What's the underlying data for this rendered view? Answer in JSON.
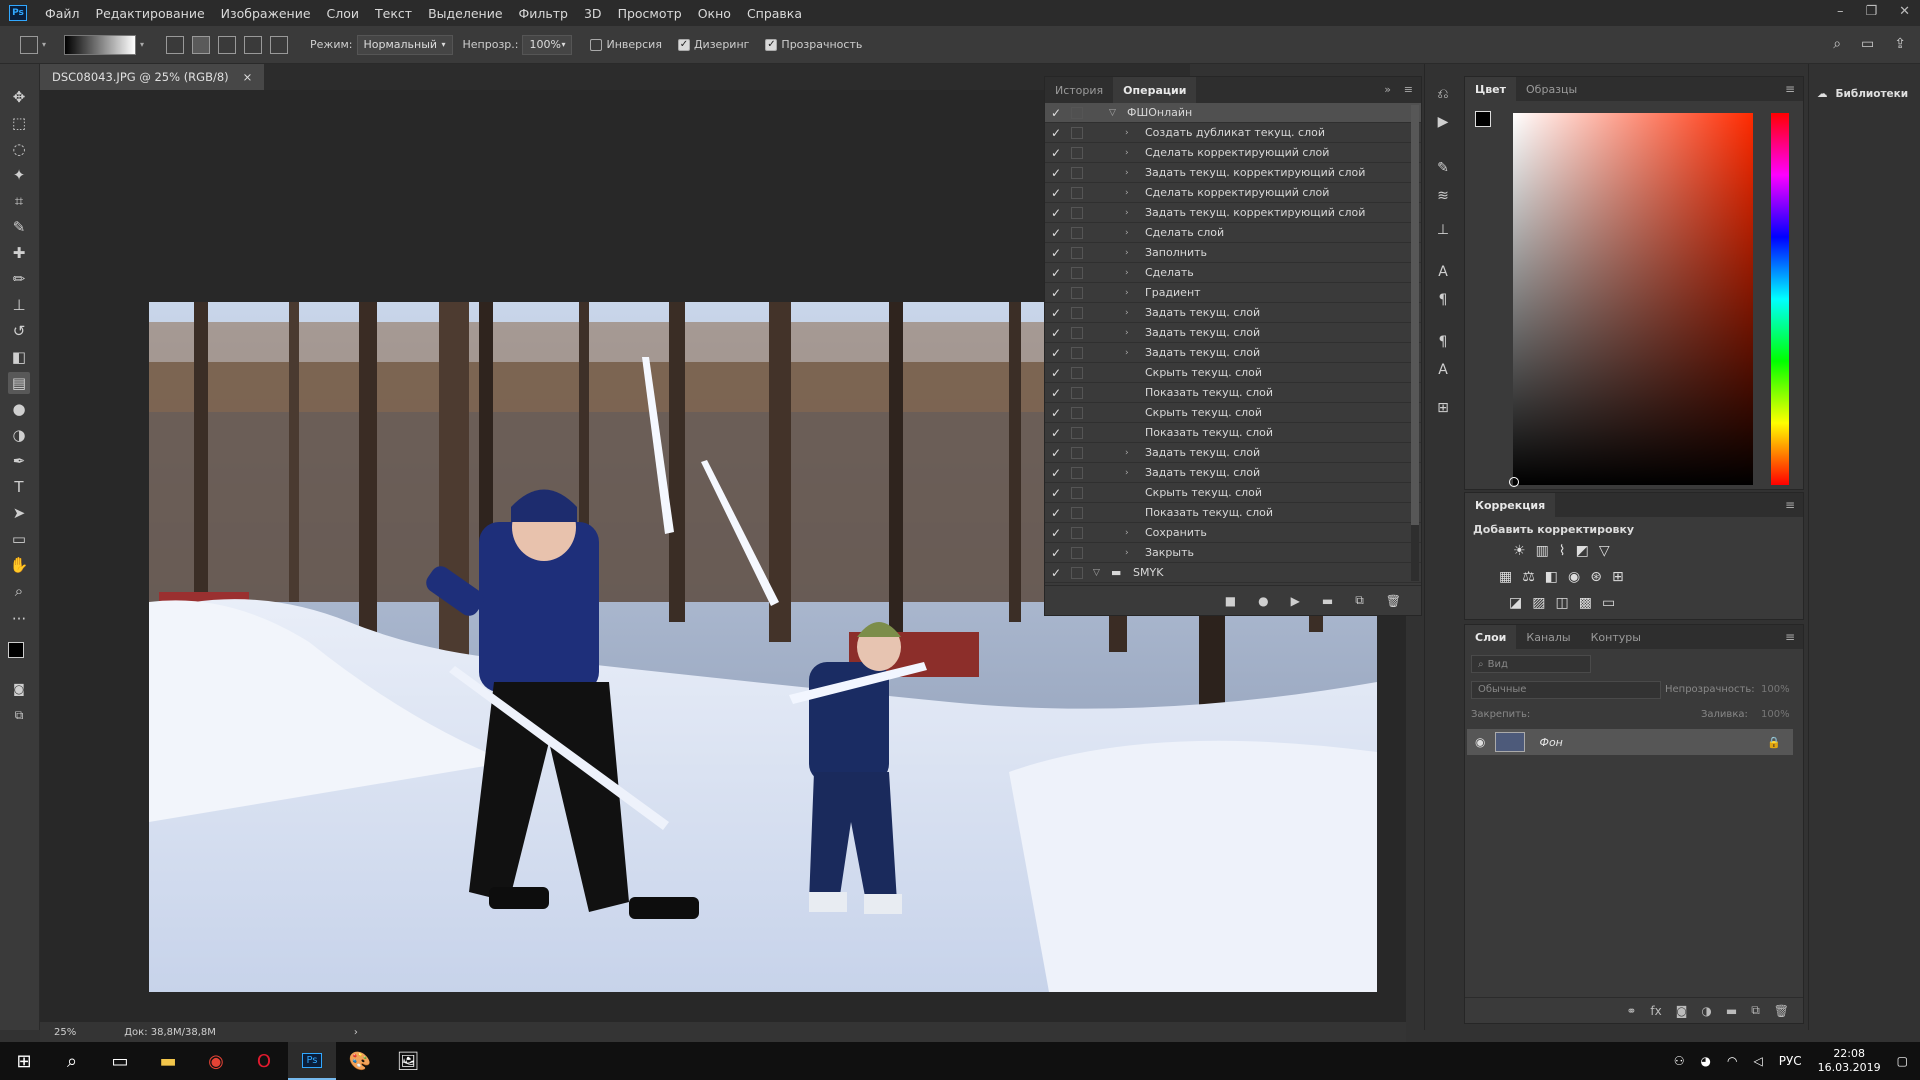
{
  "menubar": {
    "items": [
      "Файл",
      "Редактирование",
      "Изображение",
      "Слои",
      "Текст",
      "Выделение",
      "Фильтр",
      "3D",
      "Просмотр",
      "Окно",
      "Справка"
    ],
    "logo": "Ps"
  },
  "options": {
    "mode_label": "Режим:",
    "mode_value": "Нормальный",
    "opacity_label": "Непрозр.:",
    "opacity_value": "100%",
    "inverse_label": "Инверсия",
    "dither_label": "Дизеринг",
    "transparency_label": "Прозрачность"
  },
  "document": {
    "tab_title": "DSC08043.JPG @ 25% (RGB/8)",
    "close": "×",
    "zoom": "25%",
    "doc_info": "Док: 38,8M/38,8M",
    "status_arrow": "›"
  },
  "actions_panel": {
    "tabs": [
      "История",
      "Операции"
    ],
    "set_name": "ФШОнлайн",
    "items": [
      {
        "label": "Создать дубликат текущ. слой",
        "expandable": true
      },
      {
        "label": "Сделать корректирующий слой",
        "expandable": true
      },
      {
        "label": "Задать текущ. корректирующий слой",
        "expandable": true
      },
      {
        "label": "Сделать корректирующий слой",
        "expandable": true
      },
      {
        "label": "Задать текущ. корректирующий слой",
        "expandable": true
      },
      {
        "label": "Сделать слой",
        "expandable": true
      },
      {
        "label": "Заполнить",
        "expandable": true
      },
      {
        "label": "Сделать",
        "expandable": true
      },
      {
        "label": "Градиент",
        "expandable": true
      },
      {
        "label": "Задать текущ. слой",
        "expandable": true
      },
      {
        "label": "Задать текущ. слой",
        "expandable": true
      },
      {
        "label": "Задать текущ. слой",
        "expandable": true
      },
      {
        "label": "Скрыть текущ. слой",
        "expandable": false
      },
      {
        "label": "Показать текущ. слой",
        "expandable": false
      },
      {
        "label": "Скрыть текущ. слой",
        "expandable": false
      },
      {
        "label": "Показать текущ. слой",
        "expandable": false
      },
      {
        "label": "Задать текущ. слой",
        "expandable": true
      },
      {
        "label": "Задать текущ. слой",
        "expandable": true
      },
      {
        "label": "Скрыть текущ. слой",
        "expandable": false
      },
      {
        "label": "Показать текущ. слой",
        "expandable": false
      },
      {
        "label": "Сохранить",
        "expandable": true
      },
      {
        "label": "Закрыть",
        "expandable": true
      }
    ],
    "second_set": "SMYK"
  },
  "color_panel": {
    "tabs": [
      "Цвет",
      "Образцы"
    ]
  },
  "correction_panel": {
    "title": "Коррекция",
    "subtitle": "Добавить корректировку"
  },
  "layers_panel": {
    "tabs": [
      "Слои",
      "Каналы",
      "Контуры"
    ],
    "filter_placeholder": "Вид",
    "blend_mode": "Обычные",
    "opacity_label": "Непрозрачность:",
    "opacity_value": "100%",
    "lock_label": "Закрепить:",
    "fill_label": "Заливка:",
    "fill_value": "100%",
    "layer_name": "Фон"
  },
  "libraries": {
    "label": "Библиотеки"
  },
  "taskbar": {
    "lang": "РУС",
    "time": "22:08",
    "date": "16.03.2019"
  },
  "colors": {
    "accent": "#31a8ff",
    "panel_bg": "#3a3a3a",
    "canvas_bg": "#282828"
  }
}
